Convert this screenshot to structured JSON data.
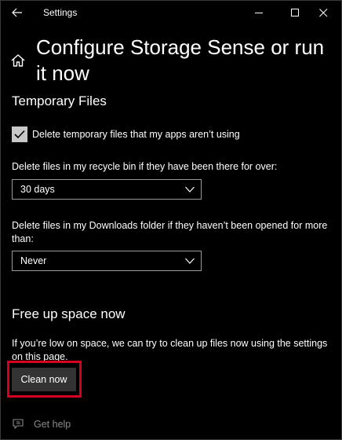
{
  "window": {
    "title": "Settings"
  },
  "page": {
    "title": "Configure Storage Sense or run it now"
  },
  "temporary_files": {
    "heading": "Temporary Files",
    "checkbox_label": "Delete temporary files that my apps aren’t using",
    "checkbox_checked": true,
    "recycle_label": "Delete files in my recycle bin if they have been there for over:",
    "recycle_value": "30 days",
    "downloads_label": "Delete files in my Downloads folder if they haven’t been opened for more than:",
    "downloads_value": "Never"
  },
  "free_up": {
    "heading": "Free up space now",
    "description": "If you’re low on space, we can try to clean up files now using the settings on this page.",
    "button_label": "Clean now"
  },
  "help": {
    "label": "Get help"
  },
  "colors": {
    "background": "#000000",
    "highlight": "#d6001c",
    "button": "#333333"
  },
  "icons": {
    "back": "back-arrow-icon",
    "home": "home-icon",
    "minimize": "minimize-icon",
    "maximize": "maximize-icon",
    "close": "close-icon",
    "checkmark": "checkmark-icon",
    "chevron": "chevron-down-icon",
    "help": "help-chat-icon"
  }
}
